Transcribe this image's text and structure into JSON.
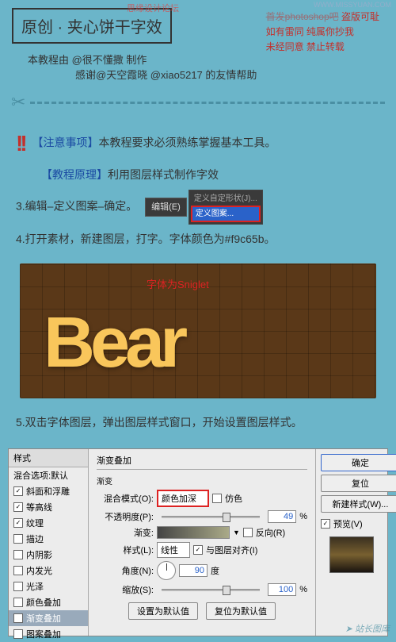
{
  "watermark_top": "思缘设计论坛",
  "url": "WWW.MISSYUAN.COM",
  "title": "原创 · 夹心饼干字效",
  "red_notice": {
    "l1a": "首发photoshop吧",
    "l1b": " 盗版可耻",
    "l2": "如有雷同 纯属你抄我",
    "l3": "未经同意 禁止转载"
  },
  "author": "本教程由 @很不懂撒 制作",
  "thanks": "感谢@天空霞晓 @xiao5217 的友情帮助",
  "notice_label": "【注意事项】",
  "notice_text": "本教程要求必须熟练掌握基本工具。",
  "principle_label": "【教程原理】",
  "principle_text": "利用图层样式制作字效",
  "step3": "3.编辑–定义图案–确定。",
  "menu_edit": "编辑(E)",
  "dd_gray": "定义自定形状(J)...",
  "dd_sel": "定义图案...",
  "step4": "4.打开素材，新建图层，打字。字体颜色为#f9c65b。",
  "bear_word": "Bear",
  "font_label": "字体为Sniglet",
  "step5": "5.双击字体图层，弹出图层样式窗口，开始设置图层样式。",
  "dialog": {
    "left_header": "样式",
    "rows": [
      {
        "t": "混合选项:默认",
        "c": false,
        "hdr": true
      },
      {
        "t": "斜面和浮雕",
        "c": true
      },
      {
        "t": "等高线",
        "c": true
      },
      {
        "t": "纹理",
        "c": true
      },
      {
        "t": "描边",
        "c": false
      },
      {
        "t": "内阴影",
        "c": false
      },
      {
        "t": "内发光",
        "c": false
      },
      {
        "t": "光泽",
        "c": false
      },
      {
        "t": "颜色叠加",
        "c": false
      },
      {
        "t": "渐变叠加",
        "c": true,
        "sel": true
      },
      {
        "t": "图案叠加",
        "c": false
      }
    ],
    "mid_title": "渐变叠加",
    "sub": "渐变",
    "blend_l": "混合模式(O):",
    "blend_v": "颜色加深",
    "dither": "仿色",
    "opa_l": "不透明度(P):",
    "opa_v": "49",
    "pct": "%",
    "grad_l": "渐变:",
    "reverse": "反向(R)",
    "style_l": "样式(L):",
    "style_v": "线性",
    "align": "与图层对齐(I)",
    "angle_l": "角度(N):",
    "angle_v": "90",
    "deg": "度",
    "scale_l": "缩放(S):",
    "scale_v": "100",
    "btn_default": "设置为默认值",
    "btn_reset": "复位为默认值",
    "ok": "确定",
    "cancel": "复位",
    "new_style": "新建样式(W)...",
    "preview": "预览(V)"
  },
  "watermark_bottom": "站长图库"
}
